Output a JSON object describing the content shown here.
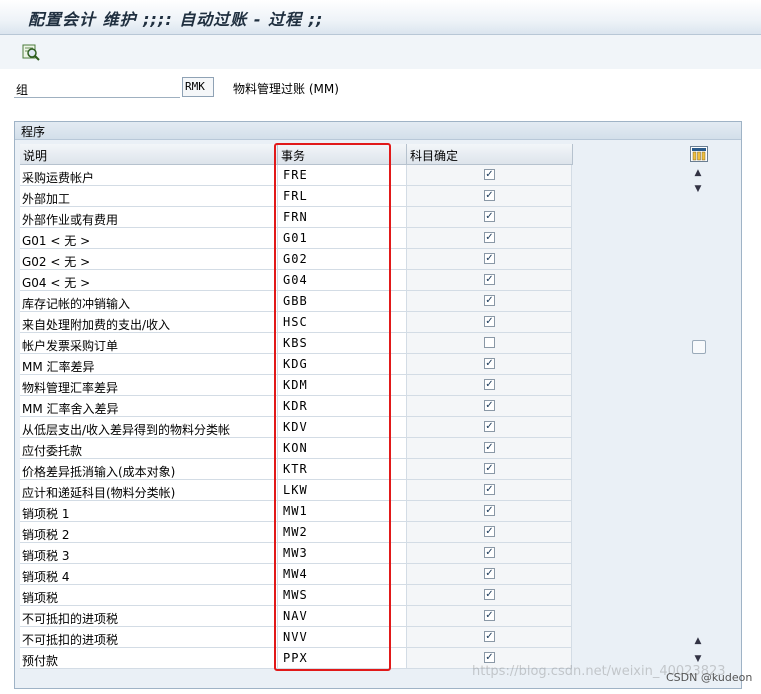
{
  "window": {
    "title": "配置会计 维护 ;;;: 自动过账 - 过程 ;;"
  },
  "toolbar": {
    "icon": "find-icon"
  },
  "group": {
    "label": "组",
    "value": "RMK",
    "description": "物料管理过账 (MM)"
  },
  "panel": {
    "title": "程序"
  },
  "table": {
    "headers": [
      "说明",
      "事务",
      "科目确定"
    ],
    "rows": [
      {
        "desc": "采购运费帐户",
        "code": "FRE",
        "checked": true
      },
      {
        "desc": "外部加工",
        "code": "FRL",
        "checked": true
      },
      {
        "desc": "外部作业或有费用",
        "code": "FRN",
        "checked": true
      },
      {
        "desc": "G01 < 无 >",
        "code": "G01",
        "checked": true
      },
      {
        "desc": "G02 < 无 >",
        "code": "G02",
        "checked": true
      },
      {
        "desc": "G04 < 无 >",
        "code": "G04",
        "checked": true
      },
      {
        "desc": "库存记帐的冲销输入",
        "code": "GBB",
        "checked": true
      },
      {
        "desc": "来自处理附加费的支出/收入",
        "code": "HSC",
        "checked": true
      },
      {
        "desc": "帐户发票采购订单",
        "code": "KBS",
        "checked": false
      },
      {
        "desc": "MM 汇率差异",
        "code": "KDG",
        "checked": true
      },
      {
        "desc": "物料管理汇率差异",
        "code": "KDM",
        "checked": true
      },
      {
        "desc": "MM 汇率舍入差异",
        "code": "KDR",
        "checked": true
      },
      {
        "desc": "从低层支出/收入差异得到的物料分类帐",
        "code": "KDV",
        "checked": true
      },
      {
        "desc": "应付委托款",
        "code": "KON",
        "checked": true
      },
      {
        "desc": "价格差异抵消输入(成本对象)",
        "code": "KTR",
        "checked": true
      },
      {
        "desc": "应计和递延科目(物料分类帐)",
        "code": "LKW",
        "checked": true
      },
      {
        "desc": "销项税 1",
        "code": "MW1",
        "checked": true
      },
      {
        "desc": "销项税 2",
        "code": "MW2",
        "checked": true
      },
      {
        "desc": "销项税 3",
        "code": "MW3",
        "checked": true
      },
      {
        "desc": "销项税 4",
        "code": "MW4",
        "checked": true
      },
      {
        "desc": "销项税",
        "code": "MWS",
        "checked": true
      },
      {
        "desc": "不可抵扣的进项税",
        "code": "NAV",
        "checked": true
      },
      {
        "desc": "不可抵扣的进项税",
        "code": "NVV",
        "checked": true
      },
      {
        "desc": "预付款",
        "code": "PPX",
        "checked": true
      }
    ]
  },
  "icons": {
    "column_settings": "column-settings-icon",
    "scroll_up": "arrow-up-icon",
    "scroll_down": "arrow-down-icon"
  },
  "highlight_color": "#e11919",
  "watermark": "https://blog.csdn.net/weixin_40023823",
  "credit": "CSDN @kudeon"
}
